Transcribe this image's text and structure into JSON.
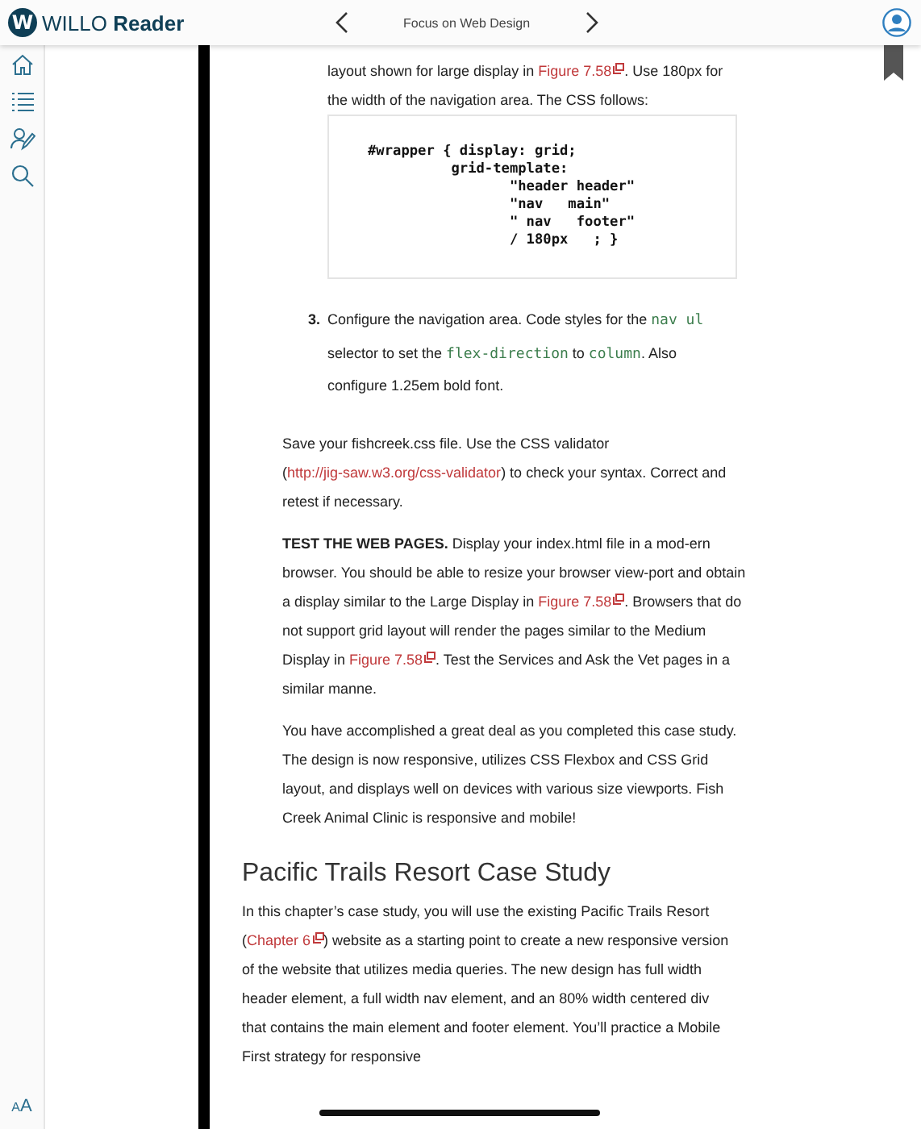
{
  "app_bar": {
    "logo_letter": "W",
    "brand": "WILLO",
    "brand_bold": "Reader",
    "book_title": "Focus on Web Design"
  },
  "sidebar": {
    "items": [
      {
        "kind": "home"
      },
      {
        "kind": "contents"
      },
      {
        "kind": "notes"
      },
      {
        "kind": "search"
      }
    ],
    "text_size_button": "AA"
  },
  "page": {
    "bookmarked": true,
    "blocks": [
      {
        "kind": "continuation",
        "runs": [
          {
            "kind": "text",
            "text": "layout shown for large display in "
          },
          {
            "kind": "link",
            "text": "Figure 7.58"
          },
          {
            "kind": "text",
            "text": ". Use 180px for the width of the navigation area. The CSS follows:"
          }
        ]
      },
      {
        "kind": "code",
        "lines": [
          "#wrapper { display: grid;",
          "          grid-template:",
          "                 \"header header\"",
          "                 \"nav   main\"",
          "                 \" nav   footer\"",
          "                 / 180px   ; }"
        ]
      },
      {
        "kind": "step",
        "number": "3.",
        "runs": [
          {
            "kind": "text",
            "text": "Configure the navigation area. Code styles for the "
          },
          {
            "kind": "code",
            "text": "nav ul"
          },
          {
            "kind": "text",
            "text": " selector to set the "
          },
          {
            "kind": "code",
            "text": "flex-direction"
          },
          {
            "kind": "text",
            "text": " to "
          },
          {
            "kind": "code",
            "text": "column"
          },
          {
            "kind": "text",
            "text": ". Also configure 1.25em bold font."
          }
        ]
      },
      {
        "kind": "paragraph",
        "runs": [
          {
            "kind": "text",
            "text": "Save your fishcreek.css file. Use the CSS validator ("
          },
          {
            "kind": "url",
            "text": "http://jig-saw.w3.org/css-validator"
          },
          {
            "kind": "text",
            "text": ") to check your syntax. Correct and retest if necessary."
          }
        ]
      },
      {
        "kind": "paragraph",
        "runs": [
          {
            "kind": "bold",
            "text": "TEST THE WEB PAGES."
          },
          {
            "kind": "text",
            "text": " Display your index.html file in a mod-ern browser. You should be able to resize your browser view-port and obtain a display similar to the Large Display in "
          },
          {
            "kind": "link",
            "text": "Figure 7.58"
          },
          {
            "kind": "text",
            "text": ". Browsers that do not support grid layout will render the pages similar to the Medium Display in "
          },
          {
            "kind": "link",
            "text": "Figure 7.58"
          },
          {
            "kind": "text",
            "text": ". Test the Services and Ask the Vet pages in a similar manne."
          }
        ]
      },
      {
        "kind": "paragraph",
        "runs": [
          {
            "kind": "text",
            "text": "You have accomplished a great deal as you completed this case study. The design is now responsive, utilizes CSS Flexbox and CSS Grid layout, and displays well on devices with various size viewports. Fish Creek Animal Clinic is responsive and mobile!"
          }
        ]
      },
      {
        "kind": "heading",
        "text": "Pacific Trails Resort Case Study"
      },
      {
        "kind": "intro",
        "runs": [
          {
            "kind": "text",
            "text": "In this chapter’s case study, you will use the existing Pacific Trails Resort ("
          },
          {
            "kind": "link",
            "text": "Chapter 6"
          },
          {
            "kind": "text",
            "text": ") website as a starting point to create a new responsive version of the website that utilizes media queries. The new design has full width header element, a full width nav element, and an 80% width centered div that contains the main element and footer element. You’ll practice a Mobile First strategy for responsive"
          }
        ]
      }
    ]
  }
}
